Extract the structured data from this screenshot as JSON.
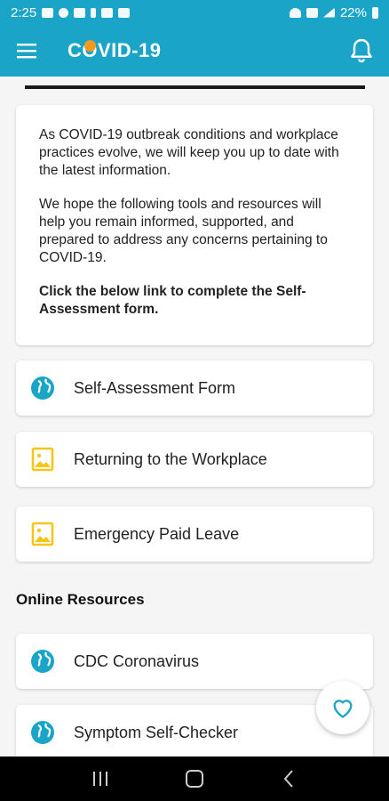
{
  "status_bar": {
    "time": "2:25",
    "battery": "22%"
  },
  "app_bar": {
    "title": "COVID-19"
  },
  "intro": {
    "paragraph1": "As COVID-19 outbreak conditions and workplace practices evolve, we will keep you up to date with the latest information.",
    "paragraph2": "We hope the following tools and resources will help you remain informed, supported, and prepared to address any concerns pertaining to COVID-19.",
    "cta": "Click the below link to complete the Self-Assessment form."
  },
  "links": [
    {
      "label": "Self-Assessment Form",
      "icon": "globe-icon"
    },
    {
      "label": "Returning to the Workplace",
      "icon": "image-icon"
    },
    {
      "label": "Emergency Paid Leave",
      "icon": "image-icon"
    }
  ],
  "online_resources": {
    "heading": "Online Resources",
    "items": [
      {
        "label": "CDC Coronavirus",
        "icon": "globe-icon"
      },
      {
        "label": "Symptom Self-Checker",
        "icon": "globe-icon"
      }
    ]
  },
  "colors": {
    "primary": "#1aa4c8",
    "accent": "#f29a1f",
    "doc_icon": "#f5c518",
    "globe_icon": "#1aa4c8"
  },
  "fab": {
    "icon": "heart-icon"
  },
  "nav": {
    "recents": "recents-icon",
    "home": "home-icon",
    "back": "back-icon"
  }
}
